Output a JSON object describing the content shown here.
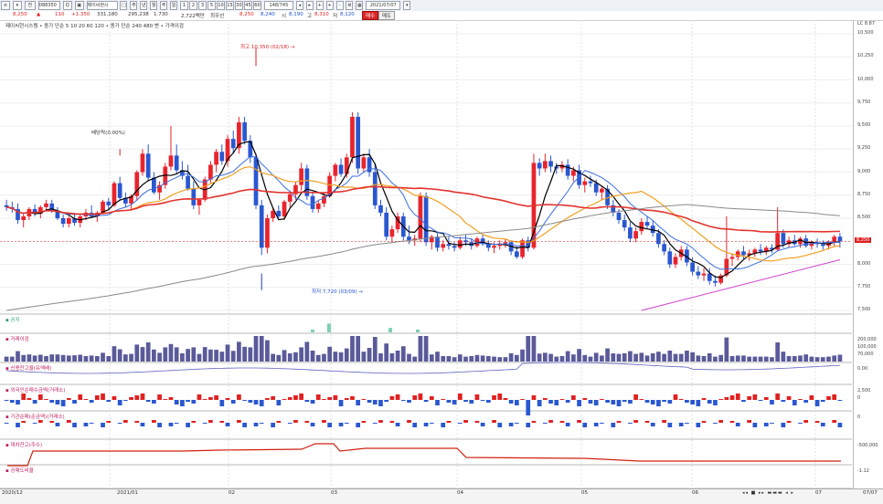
{
  "toolbar": {
    "code": "088350",
    "name": "제이씨현시",
    "periods": [
      "1",
      "2",
      "3",
      "5",
      "10",
      "15",
      "30",
      "45",
      "60"
    ],
    "count": "148/745",
    "date": "2021/07/07",
    "icons": [
      "menu-icon",
      "search-icon",
      "lock-icon",
      "chart-type-icon",
      "crosshair-icon",
      "zoom-in-icon",
      "zoom-out-icon",
      "settings-icon"
    ]
  },
  "info": {
    "price": "8,250",
    "change_sign": "▲",
    "change": "110",
    "change_pct": "+1.350",
    "volume": "331,180",
    "amount": "295,238",
    "ratio": "1.730",
    "turnover": "2,722백만",
    "hoga": "최우선",
    "ask": "8,250",
    "bid": "8,240",
    "open_label": "시",
    "open": "8,190",
    "high_label": "고",
    "high": "8,310",
    "low_label": "저",
    "low": "8,120",
    "buy_label": "매수",
    "sell_label": "매도"
  },
  "price_panel": {
    "legend": "제이씨현시스템 • 종가 단순 5  10  20  60  120 • 종가 단순 240  480  변 • 가격이검",
    "high_note": "최고 10,350 (02/18) →",
    "low_note": "최저 7,720 (03/09) →",
    "div_note": "배당락(0.00%)",
    "price_tag": "8,250",
    "hi_tag": "LC 8.87",
    "y_ticks": [
      "10,500",
      "10,250",
      "10,000",
      "9,750",
      "9,500",
      "9,250",
      "9,000",
      "8,750",
      "8,500",
      "8,250",
      "8,000",
      "7,750",
      "7,500"
    ]
  },
  "sub_panels": [
    {
      "label": "공지",
      "ticks": []
    },
    {
      "label": "거래이검",
      "ticks": [
        "200,000",
        "100,000",
        "70,000"
      ]
    },
    {
      "label": "신용잔고율(유액배)",
      "ticks": [
        "0.00"
      ]
    },
    {
      "label": "외국인순매수금액(거래소)",
      "ticks": [
        "2,500",
        "0"
      ]
    },
    {
      "label": "기관순매(순금액)(거래소)",
      "ticks": [
        "0"
      ]
    },
    {
      "label": "대차잔고(주수)",
      "ticks": [
        "-500,000"
      ]
    },
    {
      "label": "공매도비율",
      "ticks": [
        "-1.12"
      ]
    }
  ],
  "x_axis": [
    "2020/12",
    "2021/01",
    "02",
    "03",
    "04",
    "05",
    "06",
    "07"
  ],
  "x_right": "07/07",
  "colors": {
    "up": "#e8242c",
    "down": "#2a57d0",
    "ma5": "#000000",
    "ma10": "#3a6fe0",
    "ma20": "#f0a020",
    "ma60": "#e3342f",
    "ma120": "#8a8a8a",
    "ma_pink": "#d040d0"
  },
  "chart_data": {
    "type": "candlestick",
    "ohlc": [
      [
        8640,
        8700,
        8580,
        8620
      ],
      [
        8620,
        8680,
        8560,
        8600
      ],
      [
        8600,
        8660,
        8440,
        8480
      ],
      [
        8480,
        8560,
        8400,
        8520
      ],
      [
        8520,
        8620,
        8480,
        8600
      ],
      [
        8600,
        8650,
        8520,
        8550
      ],
      [
        8550,
        8640,
        8500,
        8620
      ],
      [
        8620,
        8700,
        8580,
        8660
      ],
      [
        8660,
        8700,
        8560,
        8580
      ],
      [
        8580,
        8620,
        8480,
        8500
      ],
      [
        8500,
        8540,
        8400,
        8440
      ],
      [
        8440,
        8520,
        8400,
        8500
      ],
      [
        8500,
        8560,
        8420,
        8450
      ],
      [
        8450,
        8540,
        8400,
        8520
      ],
      [
        8520,
        8600,
        8480,
        8560
      ],
      [
        8560,
        8640,
        8500,
        8520
      ],
      [
        8520,
        8580,
        8460,
        8560
      ],
      [
        8560,
        8700,
        8540,
        8680
      ],
      [
        8680,
        8720,
        8600,
        8640
      ],
      [
        8640,
        8900,
        8620,
        8880
      ],
      [
        8880,
        8950,
        8700,
        8720
      ],
      [
        8720,
        8780,
        8620,
        8660
      ],
      [
        8660,
        8760,
        8600,
        8740
      ],
      [
        8740,
        9020,
        8700,
        9000
      ],
      [
        9000,
        9250,
        8960,
        9200
      ],
      [
        9200,
        9300,
        8900,
        8940
      ],
      [
        8940,
        9000,
        8760,
        8780
      ],
      [
        8780,
        8900,
        8700,
        8860
      ],
      [
        8860,
        9100,
        8820,
        9060
      ],
      [
        9060,
        9500,
        9020,
        9180
      ],
      [
        9180,
        9300,
        8980,
        9020
      ],
      [
        9020,
        9120,
        8920,
        8960
      ],
      [
        8960,
        9080,
        8800,
        8820
      ],
      [
        8820,
        8900,
        8600,
        8640
      ],
      [
        8640,
        8720,
        8540,
        8700
      ],
      [
        8700,
        8950,
        8680,
        8920
      ],
      [
        8920,
        9120,
        8880,
        9080
      ],
      [
        9080,
        9250,
        9000,
        9220
      ],
      [
        9220,
        9300,
        9080,
        9120
      ],
      [
        9120,
        9400,
        9060,
        9360
      ],
      [
        9360,
        9450,
        9200,
        9260
      ],
      [
        9260,
        9600,
        9200,
        9540
      ],
      [
        9540,
        9600,
        9300,
        9340
      ],
      [
        9340,
        9400,
        9100,
        9160
      ],
      [
        9160,
        9200,
        8600,
        8640
      ],
      [
        8640,
        8700,
        8100,
        8180
      ],
      [
        8180,
        8540,
        8120,
        8500
      ],
      [
        8500,
        8620,
        8460,
        8580
      ],
      [
        8580,
        8640,
        8500,
        8520
      ],
      [
        8520,
        8700,
        8480,
        8680
      ],
      [
        8680,
        8800,
        8620,
        8760
      ],
      [
        8760,
        8900,
        8700,
        8860
      ],
      [
        8860,
        9100,
        8800,
        9040
      ],
      [
        9040,
        9080,
        8700,
        8740
      ],
      [
        8740,
        8780,
        8560,
        8600
      ],
      [
        8600,
        8700,
        8560,
        8660
      ],
      [
        8660,
        8780,
        8620,
        8740
      ],
      [
        8740,
        9000,
        8720,
        8960
      ],
      [
        8960,
        9100,
        8900,
        9080
      ],
      [
        9080,
        9150,
        8950,
        8980
      ],
      [
        8980,
        9200,
        8940,
        9160
      ],
      [
        9160,
        9650,
        9100,
        9600
      ],
      [
        9600,
        9650,
        8980,
        9040
      ],
      [
        9040,
        9200,
        9000,
        9160
      ],
      [
        9160,
        9250,
        8950,
        9000
      ],
      [
        9000,
        9100,
        8600,
        8640
      ],
      [
        8640,
        8700,
        8520,
        8560
      ],
      [
        8560,
        8620,
        8260,
        8300
      ],
      [
        8300,
        8420,
        8240,
        8380
      ],
      [
        8380,
        8560,
        8340,
        8520
      ],
      [
        8520,
        8560,
        8260,
        8300
      ],
      [
        8300,
        8420,
        8220,
        8260
      ],
      [
        8260,
        8320,
        8200,
        8280
      ],
      [
        8280,
        8780,
        8240,
        8740
      ],
      [
        8740,
        8780,
        8200,
        8240
      ],
      [
        8240,
        8320,
        8160,
        8300
      ],
      [
        8300,
        8340,
        8140,
        8180
      ],
      [
        8180,
        8260,
        8140,
        8220
      ],
      [
        8220,
        8300,
        8160,
        8200
      ],
      [
        8200,
        8240,
        8140,
        8180
      ],
      [
        8180,
        8300,
        8160,
        8260
      ],
      [
        8260,
        8320,
        8200,
        8240
      ],
      [
        8240,
        8280,
        8160,
        8200
      ],
      [
        8200,
        8300,
        8180,
        8280
      ],
      [
        8280,
        8320,
        8200,
        8220
      ],
      [
        8220,
        8260,
        8140,
        8180
      ],
      [
        8180,
        8240,
        8120,
        8200
      ],
      [
        8200,
        8260,
        8160,
        8220
      ],
      [
        8220,
        8280,
        8180,
        8240
      ],
      [
        8240,
        8260,
        8100,
        8140
      ],
      [
        8140,
        8200,
        8060,
        8080
      ],
      [
        8080,
        8280,
        8060,
        8260
      ],
      [
        8260,
        8300,
        8140,
        8180
      ],
      [
        8180,
        9200,
        8160,
        9100
      ],
      [
        9100,
        9150,
        8960,
        9040
      ],
      [
        9040,
        9200,
        9000,
        9120
      ],
      [
        9120,
        9180,
        9000,
        9060
      ],
      [
        9060,
        9100,
        8980,
        9040
      ],
      [
        9040,
        9120,
        9000,
        9080
      ],
      [
        9080,
        9140,
        8920,
        8960
      ],
      [
        8960,
        9060,
        8900,
        9020
      ],
      [
        9020,
        9080,
        8820,
        8860
      ],
      [
        8860,
        8940,
        8780,
        8900
      ],
      [
        8900,
        8960,
        8840,
        8880
      ],
      [
        8880,
        8920,
        8740,
        8780
      ],
      [
        8780,
        8840,
        8700,
        8820
      ],
      [
        8820,
        8860,
        8600,
        8640
      ],
      [
        8640,
        8700,
        8520,
        8560
      ],
      [
        8560,
        8600,
        8440,
        8480
      ],
      [
        8480,
        8540,
        8360,
        8400
      ],
      [
        8400,
        8460,
        8240,
        8280
      ],
      [
        8280,
        8400,
        8240,
        8360
      ],
      [
        8360,
        8500,
        8320,
        8460
      ],
      [
        8460,
        8520,
        8380,
        8420
      ],
      [
        8420,
        8480,
        8300,
        8340
      ],
      [
        8340,
        8380,
        8180,
        8220
      ],
      [
        8220,
        8260,
        8100,
        8140
      ],
      [
        8140,
        8180,
        7960,
        8000
      ],
      [
        8000,
        8120,
        7960,
        8080
      ],
      [
        8080,
        8200,
        8040,
        8160
      ],
      [
        8160,
        8200,
        7980,
        8020
      ],
      [
        8020,
        8080,
        7880,
        7920
      ],
      [
        7920,
        7980,
        7840,
        7880
      ],
      [
        7880,
        7960,
        7820,
        7900
      ],
      [
        7900,
        7960,
        7780,
        7820
      ],
      [
        7820,
        7880,
        7760,
        7800
      ],
      [
        7800,
        7900,
        7780,
        7880
      ],
      [
        7880,
        8520,
        7860,
        8060
      ],
      [
        8060,
        8120,
        7980,
        8080
      ],
      [
        8080,
        8160,
        8040,
        8140
      ],
      [
        8140,
        8200,
        8060,
        8100
      ],
      [
        8100,
        8160,
        8040,
        8120
      ],
      [
        8120,
        8180,
        8080,
        8160
      ],
      [
        8160,
        8220,
        8100,
        8140
      ],
      [
        8140,
        8200,
        8100,
        8180
      ],
      [
        8180,
        8220,
        8120,
        8160
      ],
      [
        8160,
        8620,
        8140,
        8340
      ],
      [
        8340,
        8380,
        8180,
        8220
      ],
      [
        8220,
        8300,
        8180,
        8260
      ],
      [
        8260,
        8320,
        8200,
        8220
      ],
      [
        8220,
        8300,
        8180,
        8280
      ],
      [
        8280,
        8320,
        8180,
        8200
      ],
      [
        8200,
        8260,
        8160,
        8240
      ],
      [
        8240,
        8280,
        8180,
        8220
      ],
      [
        8220,
        8260,
        8160,
        8200
      ],
      [
        8200,
        8260,
        8160,
        8240
      ],
      [
        8240,
        8320,
        8200,
        8300
      ],
      [
        8300,
        8340,
        8180,
        8250
      ]
    ],
    "y_range": [
      7500,
      10550
    ]
  }
}
